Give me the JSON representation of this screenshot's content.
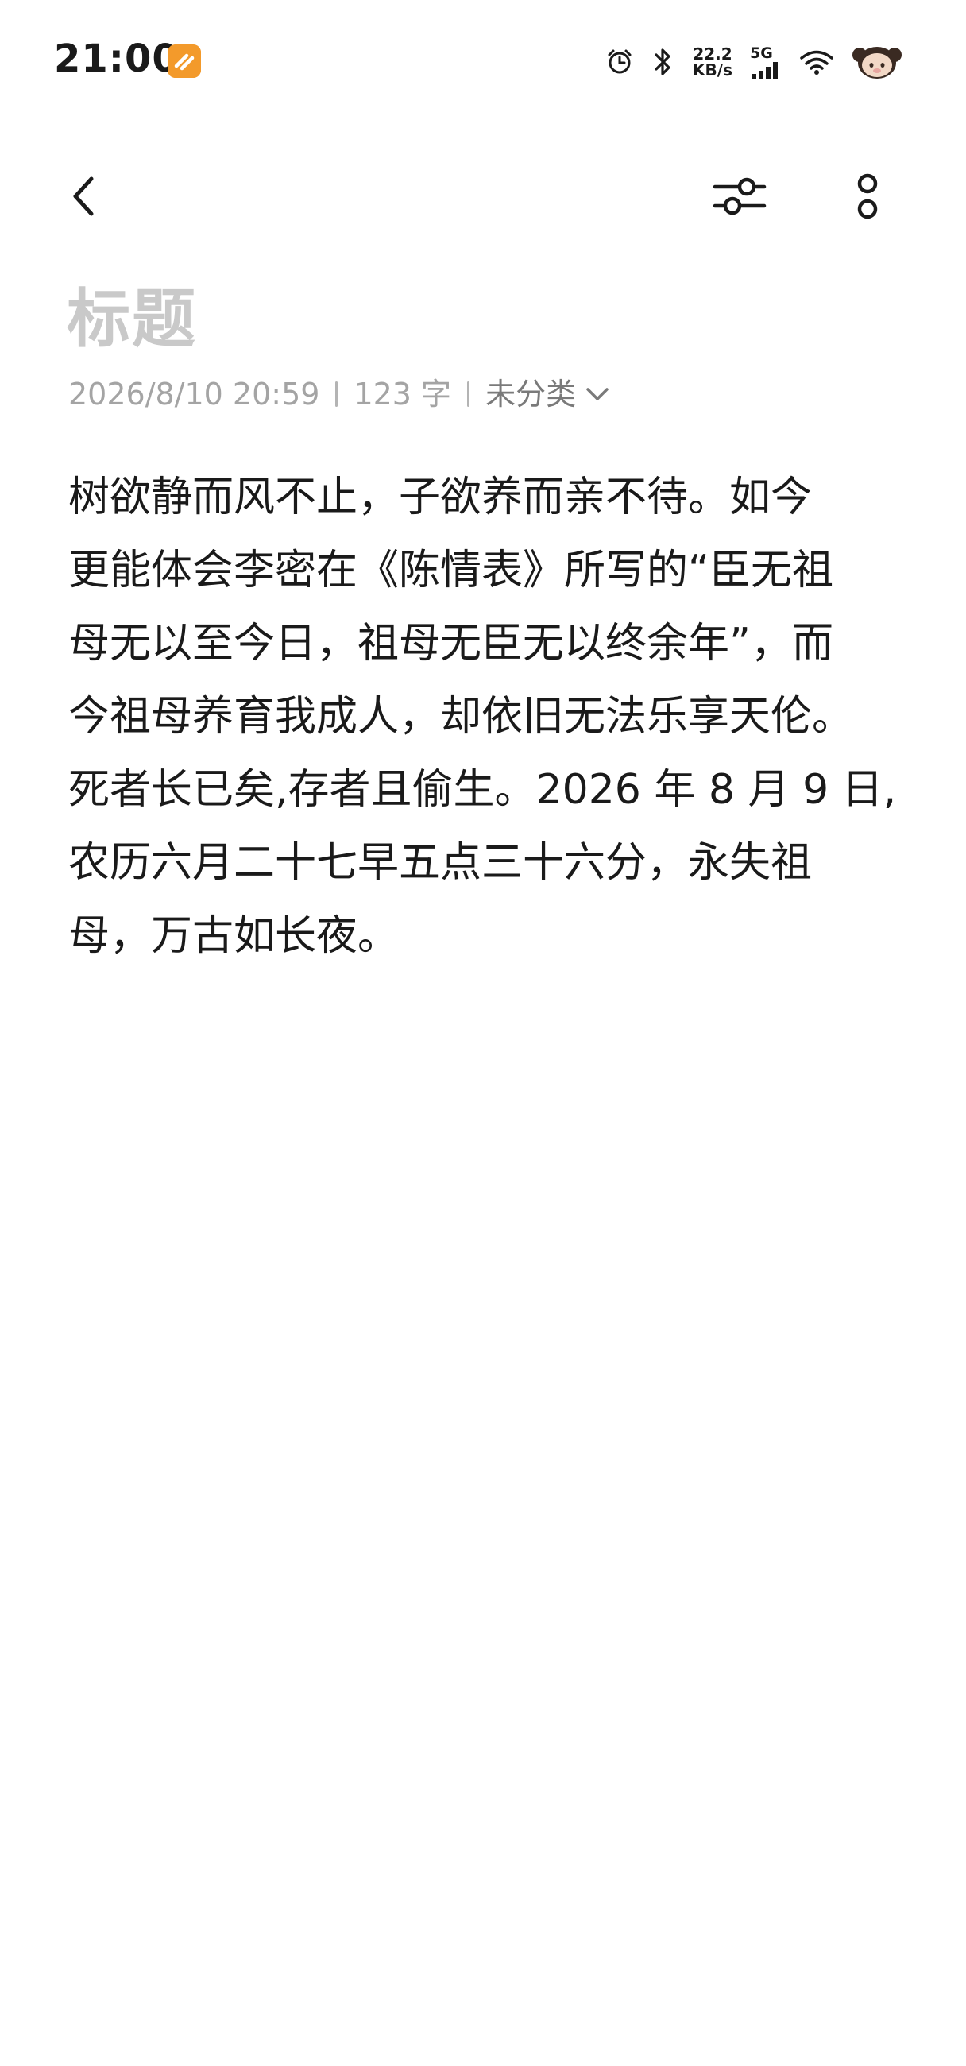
{
  "status_bar": {
    "time": "21:00",
    "network_speed_value": "22.2",
    "network_speed_unit": "KB/s",
    "network_type": "5G",
    "icons": [
      "alarm-icon",
      "bluetooth-icon",
      "signal-icon",
      "wifi-icon",
      "avatar-icon"
    ],
    "app_badge_color": "#f39a2b"
  },
  "toolbar": {
    "back_icon": "chevron-left-icon",
    "filter_icon": "sliders-icon",
    "more_icon": "more-vertical-icon"
  },
  "note": {
    "title_placeholder": "标题",
    "date_time": "2026/8/10 20:59",
    "word_count": "123 字",
    "category": "未分类",
    "body_lines": [
      "树欲静而风不止，子欲养而亲不待。如今",
      "更能体会李密在《陈情表》所写的“臣无祖",
      "母无以至今日，祖母无臣无以终余年”，而",
      "今祖母养育我成人，却依旧无法乐享天伦。",
      "死者长已矣,存者且偷生。2026 年 8 月 9 日,",
      "农历六月二十七早五点三十六分，永失祖",
      "母，万古如长夜。"
    ]
  },
  "colors": {
    "text_primary": "#1a1a1a",
    "title_placeholder": "#c9c9c9",
    "meta_text": "#a4a4a4",
    "background": "#ffffff"
  }
}
